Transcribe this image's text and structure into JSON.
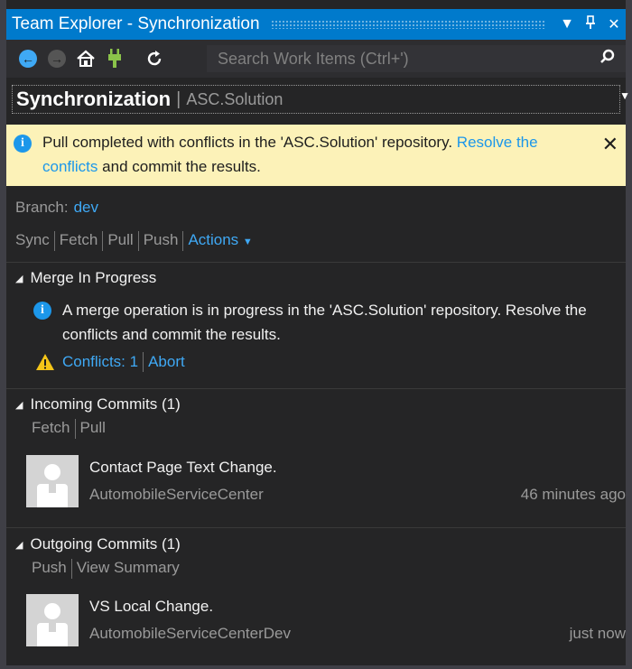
{
  "window": {
    "title": "Team Explorer - Synchronization",
    "pin_icon": "pin-icon",
    "dropdown_icon": "dropdown-arrow-icon",
    "close_icon": "close-icon"
  },
  "toolbar": {
    "back_icon": "back-arrow-icon",
    "forward_icon": "forward-arrow-icon",
    "home_icon": "home-icon",
    "connect_icon": "plug-icon",
    "refresh_icon": "refresh-icon",
    "search_placeholder": "Search Work Items (Ctrl+')",
    "search_icon": "search-icon"
  },
  "header": {
    "title": "Synchronization",
    "separator": "|",
    "subtitle": "ASC.Solution"
  },
  "infobar": {
    "text_before": "Pull completed with conflicts in the 'ASC.Solution' repository.",
    "link_text": "Resolve the conflicts",
    "text_after": "and commit the results."
  },
  "branch": {
    "label": "Branch:",
    "value": "dev"
  },
  "actions": {
    "sync": "Sync",
    "fetch": "Fetch",
    "pull": "Pull",
    "push": "Push",
    "actions": "Actions"
  },
  "merge": {
    "title": "Merge In Progress",
    "message": "A merge operation is in progress in the 'ASC.Solution' repository. Resolve the conflicts and commit the results.",
    "conflicts": "Conflicts: 1",
    "abort": "Abort"
  },
  "incoming": {
    "title": "Incoming Commits (1)",
    "fetch": "Fetch",
    "pull": "Pull",
    "commits": [
      {
        "message": "Contact Page Text Change.",
        "author": "AutomobileServiceCenter",
        "time": "46 minutes ago"
      }
    ]
  },
  "outgoing": {
    "title": "Outgoing Commits (1)",
    "push": "Push",
    "view_summary": "View Summary",
    "commits": [
      {
        "message": "VS Local Change.",
        "author": "AutomobileServiceCenterDev",
        "time": "just now"
      }
    ]
  },
  "colors": {
    "accent": "#007acc",
    "link": "#3fa9f5",
    "infobar_bg": "#fcf2b8",
    "warning": "#f5c518"
  }
}
